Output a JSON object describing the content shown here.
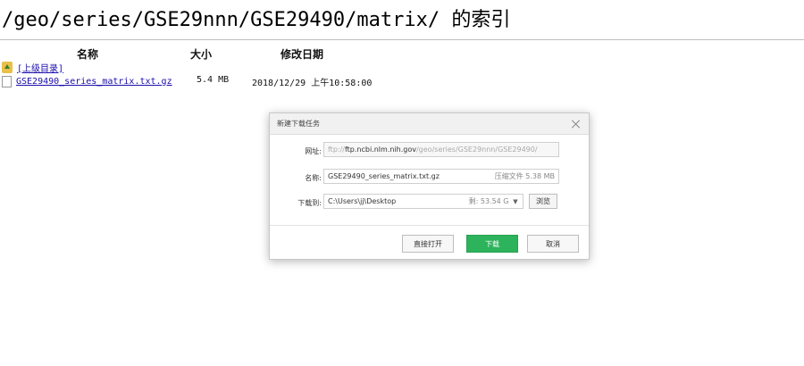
{
  "page": {
    "title": "/geo/series/GSE29nnn/GSE29490/matrix/ 的索引"
  },
  "listing": {
    "headers": {
      "name": "名称",
      "size": "大小",
      "date": "修改日期"
    },
    "parent": {
      "label": "[上级目录]"
    },
    "files": [
      {
        "name": "GSE29490_series_matrix.txt.gz",
        "size": "5.4 MB",
        "date": "2018/12/29 上午10:58:00"
      }
    ]
  },
  "dialog": {
    "title": "新建下载任务",
    "url": {
      "label": "网址:",
      "prefix": "ftp://",
      "host": "ftp.ncbi.nlm.nih.gov",
      "path": "/geo/series/GSE29nnn/GSE29490/"
    },
    "name": {
      "label": "名称:",
      "value": "GSE29490_series_matrix.txt.gz",
      "hint": "压缩文件 5.38 MB"
    },
    "save_to": {
      "label": "下载到:",
      "value": "C:\\Users\\jj\\Desktop",
      "free": "剩: 53.54 GB",
      "dropdown": "▼",
      "browse": "浏览"
    },
    "buttons": {
      "open": "直接打开",
      "download": "下载",
      "cancel": "取消"
    }
  }
}
